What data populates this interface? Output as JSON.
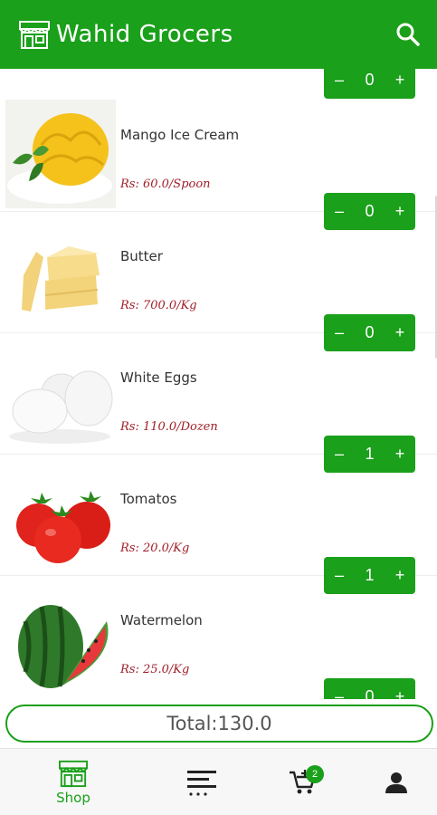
{
  "app": {
    "title": "Wahid Grocers"
  },
  "partial_item": {
    "minus": "–",
    "qty": "0",
    "plus": "+"
  },
  "items": [
    {
      "name": "Mango Ice Cream",
      "price": "Rs: 60.0/Spoon",
      "qty": "0"
    },
    {
      "name": "Butter",
      "price": "Rs: 700.0/Kg",
      "qty": "0"
    },
    {
      "name": "White Eggs",
      "price": "Rs: 110.0/Dozen",
      "qty": "1"
    },
    {
      "name": "Tomatos",
      "price": "Rs: 20.0/Kg",
      "qty": "1"
    },
    {
      "name": "Watermelon",
      "price": "Rs: 25.0/Kg",
      "qty": "0"
    }
  ],
  "stepper": {
    "minus": "–",
    "plus": "+"
  },
  "total": "Total:130.0",
  "nav": {
    "shop_label": "Shop",
    "cart_badge": "2"
  },
  "colors": {
    "accent": "#1aa01a",
    "price": "#a0202a"
  }
}
